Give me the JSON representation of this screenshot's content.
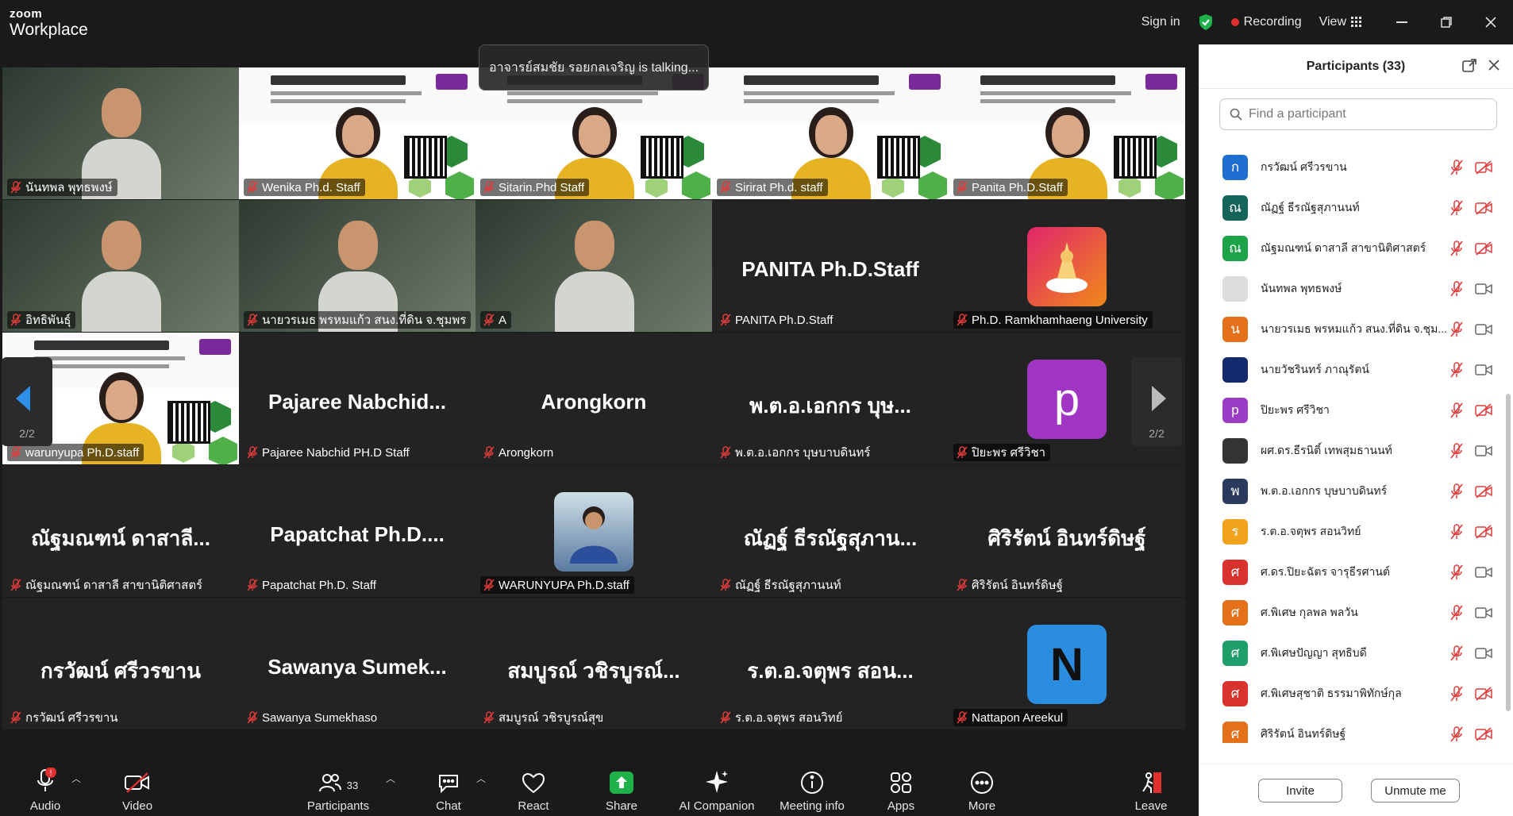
{
  "app": {
    "brand_top": "zoom",
    "brand_bottom": "Workplace"
  },
  "topbar": {
    "sign_in": "Sign in",
    "recording": "Recording",
    "view": "View"
  },
  "talking": "อาจารย์สมชัย รอยกลเจริญ is talking...",
  "pager": {
    "left": "2/2",
    "right": "2/2"
  },
  "tiles": [
    {
      "name": "นันทพล พุทธพงษ์",
      "kind": "video"
    },
    {
      "name": "Wenika Ph.d. Staff",
      "kind": "slide"
    },
    {
      "name": "Sitarin.Phd Staff",
      "kind": "slide"
    },
    {
      "name": "Sirirat Ph.d. staff",
      "kind": "slide"
    },
    {
      "name": "Panita Ph.D.Staff",
      "kind": "slide"
    },
    {
      "name": "อิทธิพันธุ์",
      "kind": "video"
    },
    {
      "name": "นายวรเมธ พรหมแก้ว สนง.ที่ดิน จ.ชุมพร",
      "kind": "video"
    },
    {
      "name": "A",
      "kind": "video"
    },
    {
      "name": "PANITA Ph.D.Staff",
      "big": "PANITA Ph.D.Staff",
      "kind": "plain"
    },
    {
      "name": "Ph.D. Ramkhamhaeng University",
      "kind": "avatar",
      "avatar": "logo"
    },
    {
      "name": "warunyupa Ph.D.staff",
      "kind": "slide"
    },
    {
      "name": "Pajaree Nabchid PH.D Staff",
      "big": "Pajaree  Nabchid...",
      "kind": "plain"
    },
    {
      "name": "Arongkorn",
      "big": "Arongkorn",
      "kind": "plain"
    },
    {
      "name": "พ.ต.อ.เอกกร บุษบาบดินทร์",
      "big": "พ.ต.อ.เอกกร บุษ...",
      "kind": "plain"
    },
    {
      "name": "ปิยะพร ศรีวิชา",
      "kind": "avatar",
      "avatar": "p"
    },
    {
      "name": "ณัฐมณฑน์ ดาสาลี สาขานิติศาสตร์",
      "big": "ณัฐมณฑน์ ดาสาลี...",
      "kind": "plain"
    },
    {
      "name": "Papatchat Ph.D. Staff",
      "big": "Papatchat  Ph.D....",
      "kind": "plain"
    },
    {
      "name": "WARUNYUPA Ph.D.staff",
      "kind": "avatar",
      "avatar": "photo"
    },
    {
      "name": "ณัฏฐ์ ธีรณัฐสุภานนท์",
      "big": "ณัฏฐ์ ธีรณัฐสุภาน...",
      "kind": "plain"
    },
    {
      "name": "ศิริรัตน์ อินทร์ดิษฐ์",
      "big": "ศิริรัตน์ อินทร์ดิษฐ์",
      "kind": "plain"
    },
    {
      "name": "กรวัฒน์ ศรีวรขาน",
      "big": "กรวัฒน์ ศรีวรขาน",
      "kind": "plain"
    },
    {
      "name": "Sawanya Sumekhaso",
      "big": "Sawanya  Sumek...",
      "kind": "plain"
    },
    {
      "name": "สมบูรณ์ วชิรบูรณ์สุข",
      "big": "สมบูรณ์ วชิรบูรณ์...",
      "kind": "plain"
    },
    {
      "name": "ร.ต.อ.จตุพร สอนวิทย์",
      "big": "ร.ต.อ.จตุพร สอน...",
      "kind": "plain"
    },
    {
      "name": "Nattapon Areekul",
      "kind": "avatar",
      "avatar": "N"
    }
  ],
  "panel": {
    "title": "Participants (33)",
    "search_placeholder": "Find a participant",
    "participants": [
      {
        "name": "กรวัฒน์ ศรีวรขาน",
        "initial": "ก",
        "color": "#1f6fd1",
        "video": "off"
      },
      {
        "name": "ณัฏฐ์ ธีรณัฐสุภานนท์",
        "initial": "ณ",
        "color": "#14645a",
        "video": "off"
      },
      {
        "name": "ณัฐมณฑน์ ดาสาลี สาขานิติศาสตร์",
        "initial": "ณ",
        "color": "#1ea24a",
        "video": "off"
      },
      {
        "name": "นันทพล พุทธพงษ์",
        "initial": "",
        "color": "#dddddd",
        "video": "on"
      },
      {
        "name": "นายวรเมธ  พรหมแก้ว  สนง.ที่ดิน จ.ชุม...",
        "initial": "น",
        "color": "#e4701a",
        "video": "on"
      },
      {
        "name": "นายวัชรินทร์ ภาณุรัตน์",
        "initial": "",
        "color": "#122a6b",
        "video": "on"
      },
      {
        "name": "ปิยะพร ศรีวิชา",
        "initial": "p",
        "color": "#9b3dc7",
        "video": "off"
      },
      {
        "name": "ผศ.ดร.ธีรนิติ์ เทพสุมธานนท์",
        "initial": "",
        "color": "#333333",
        "video": "on"
      },
      {
        "name": "พ.ต.อ.เอกกร บุษบาบดินทร์",
        "initial": "พ",
        "color": "#2a3a5e",
        "video": "off"
      },
      {
        "name": "ร.ต.อ.จตุพร สอนวิทย์",
        "initial": "ร",
        "color": "#f1a21a",
        "video": "off"
      },
      {
        "name": "ศ.ดร.ปิยะฉัตร จารุธีรศานต์",
        "initial": "ศ",
        "color": "#d8322e",
        "video": "on"
      },
      {
        "name": "ศ.พิเศษ กุลพล พลวัน",
        "initial": "ศ",
        "color": "#e4701a",
        "video": "on"
      },
      {
        "name": "ศ.พิเศษปัญญา สุทธิบดี",
        "initial": "ศ",
        "color": "#1e9e6a",
        "video": "on"
      },
      {
        "name": "ศ.พิเศษสุชาติ ธรรมาพิทักษ์กุล",
        "initial": "ศ",
        "color": "#d8322e",
        "video": "off"
      },
      {
        "name": "ศิริรัตน์ อินทร์ดิษฐ์",
        "initial": "ศ",
        "color": "#e4701a",
        "video": "off"
      }
    ],
    "invite": "Invite",
    "unmute": "Unmute me"
  },
  "toolbar": {
    "audio": "Audio",
    "audio_badge": "!",
    "video": "Video",
    "participants": "Participants",
    "participants_count": "33",
    "chat": "Chat",
    "react": "React",
    "share": "Share",
    "ai": "AI Companion",
    "meeting_info": "Meeting info",
    "apps": "Apps",
    "more": "More",
    "leave": "Leave"
  }
}
